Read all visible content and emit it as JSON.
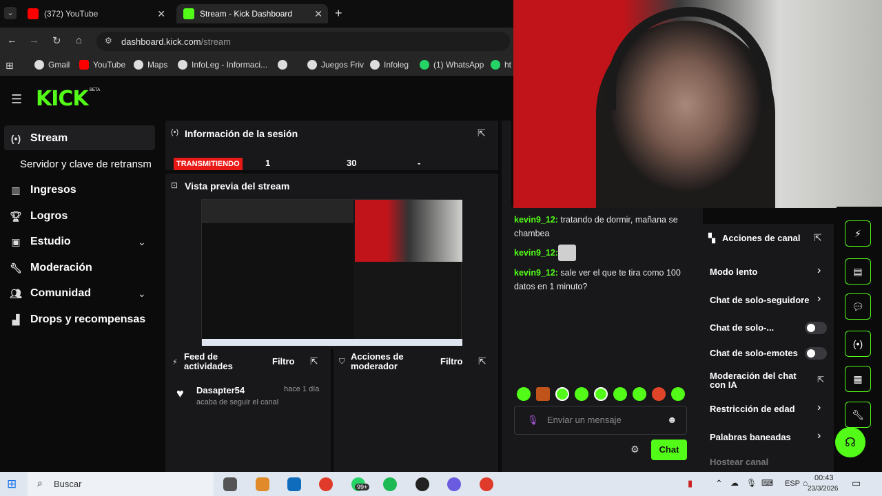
{
  "browser": {
    "tabs": [
      {
        "label": "(372) YouTube"
      },
      {
        "label": "Stream - Kick Dashboard"
      }
    ],
    "url_domain": "dashboard.kick.com",
    "url_path": "/stream",
    "bookmarks": [
      "Gmail",
      "YouTube",
      "Maps",
      "InfoLeg - Informaci...",
      "Juegos Friv",
      "Infoleg",
      "(1) WhatsApp",
      "ht"
    ]
  },
  "kick": {
    "logo": "KICK",
    "beta": "BETA",
    "sidebar": {
      "stream": "Stream",
      "server_key": "Servidor y clave de retransm",
      "ingresos": "Ingresos",
      "logros": "Logros",
      "estudio": "Estudio",
      "moderacion": "Moderación",
      "comunidad": "Comunidad",
      "drops": "Drops y recompensas"
    },
    "session": {
      "title": "Información de la sesión",
      "status": "TRANSMITIENDO",
      "stat1": "1",
      "stat2": "30",
      "stat3": "-"
    },
    "preview": {
      "title": "Vista previa del stream"
    },
    "feed": {
      "title": "Feed de actividades",
      "filter": "Filtro",
      "user": "Dasapter54",
      "time": "hace 1 día",
      "action": "acaba de seguir el canal"
    },
    "modactions": {
      "title": "Acciones de moderador",
      "filter": "Filtro"
    },
    "chat": {
      "messages": [
        {
          "user": "kevin9_12:",
          "text": "tratando de dormir, mañana se chambea"
        },
        {
          "user": "kevin9_12:",
          "text": ""
        },
        {
          "user": "kevin9_12:",
          "text": "sale ver el que te tira como 100 datos en 1 minuto?"
        }
      ],
      "placeholder": "Enviar un mensaje",
      "send": "Chat"
    },
    "channel_actions": {
      "title": "Acciones de canal",
      "items": [
        "Modo lento",
        "Chat de solo-seguidore",
        "Chat de solo-...",
        "Chat de solo-emotes",
        "Moderación del chat con IA",
        "Restricción de edad",
        "Palabras baneadas",
        "Hostear canal"
      ]
    }
  },
  "taskbar": {
    "search": "Buscar",
    "lang": "ESP",
    "time": "00:43",
    "date": "23/3/2026",
    "badge": "99+"
  },
  "colors": {
    "kick_green": "#53fc18",
    "live_red": "#e91916"
  }
}
